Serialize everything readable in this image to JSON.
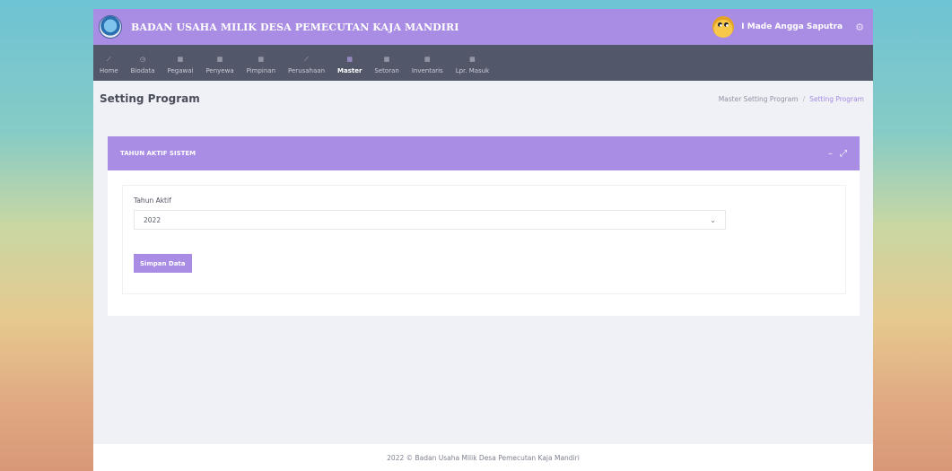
{
  "topbar": {
    "app_title": "BADAN USAHA MILIK DESA PEMECUTAN KAJA MANDIRI",
    "user_name": "I Made Angga Saputra",
    "settings_icon": "gear-icon"
  },
  "nav": {
    "items": [
      {
        "label": "Home",
        "icon": "tool-icon",
        "active": false
      },
      {
        "label": "Biodata",
        "icon": "clock-icon",
        "active": false
      },
      {
        "label": "Pegawai",
        "icon": "grid-icon",
        "active": false
      },
      {
        "label": "Penyewa",
        "icon": "grid-icon",
        "active": false
      },
      {
        "label": "Pimpinan",
        "icon": "grid-icon",
        "active": false
      },
      {
        "label": "Perusahaan",
        "icon": "tool-icon",
        "active": false
      },
      {
        "label": "Master",
        "icon": "grid-icon",
        "active": true
      },
      {
        "label": "Setoran",
        "icon": "grid-icon",
        "active": false
      },
      {
        "label": "Inventaris",
        "icon": "grid-icon",
        "active": false
      },
      {
        "label": "Lpr. Masuk",
        "icon": "grid-icon",
        "active": false
      }
    ]
  },
  "page": {
    "title": "Setting Program",
    "breadcrumb": {
      "parent": "Master Setting Program",
      "separator": "/",
      "current": "Setting Program"
    }
  },
  "card": {
    "title": "TAHUN AKTIF SISTEM",
    "minimize": "–",
    "expand": "⤢",
    "field_label": "Tahun Aktif",
    "selected_year": "2022",
    "save_label": "Simpan Data"
  },
  "footer": {
    "text": "2022 © Badan Usaha Milik Desa Pemecutan Kaja Mandiri"
  },
  "colors": {
    "accent": "#a98ce3",
    "navbar": "#53576a",
    "background": "#f0f1f6"
  }
}
